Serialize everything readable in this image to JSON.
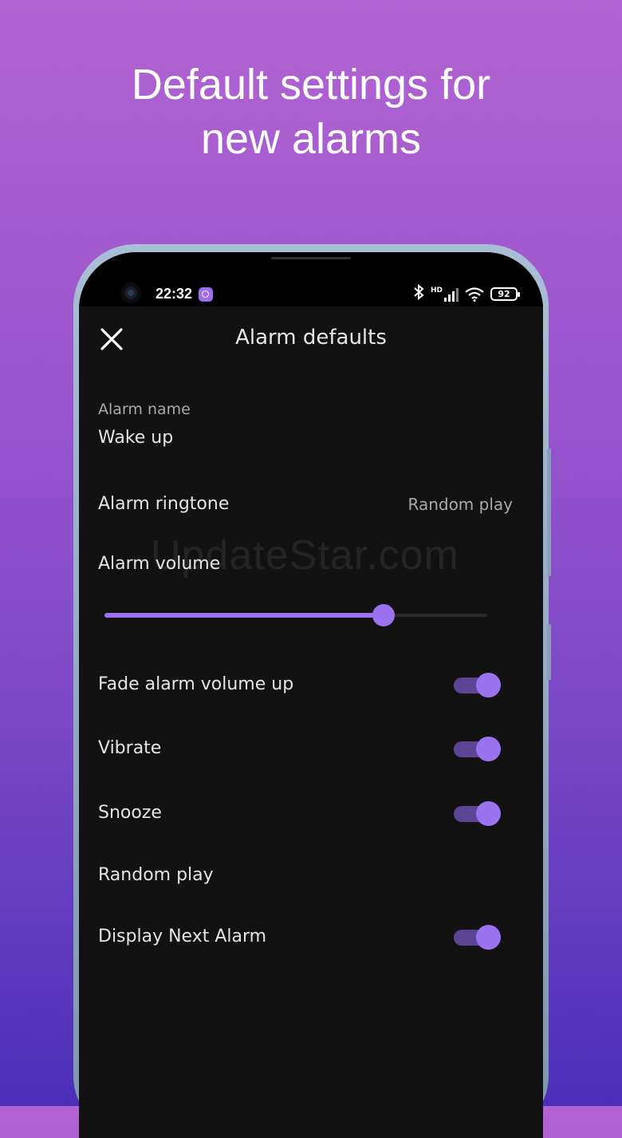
{
  "promo": {
    "headline_line1": "Default settings for",
    "headline_line2": "new alarms"
  },
  "status_bar": {
    "time": "22:32",
    "network_tag": "HD",
    "battery_level": "92",
    "icons": [
      "alarm-app-icon",
      "bluetooth-icon",
      "signal-icon",
      "wifi-icon",
      "battery-icon"
    ]
  },
  "app_bar": {
    "close_icon": "close-icon",
    "title": "Alarm defaults"
  },
  "settings": {
    "alarm_name": {
      "label": "Alarm name",
      "value": "Wake up"
    },
    "ringtone": {
      "label": "Alarm ringtone",
      "value": "Random play"
    },
    "volume": {
      "label": "Alarm volume",
      "level_fraction": 0.73
    },
    "fade_volume": {
      "label": "Fade alarm volume up",
      "enabled": true
    },
    "vibrate": {
      "label": "Vibrate",
      "enabled": true
    },
    "snooze": {
      "label": "Snooze",
      "enabled": true
    },
    "random_play": {
      "label": "Random play"
    },
    "display_next_alarm": {
      "label": "Display Next Alarm",
      "enabled": true
    }
  },
  "watermark": "UpdateStar.com",
  "colors": {
    "accent": "#9b72f0",
    "toggle_track": "#5d4596",
    "screen_background": "#121212",
    "gradient_top": "#b263d2",
    "gradient_bottom": "#4b2fb8"
  }
}
